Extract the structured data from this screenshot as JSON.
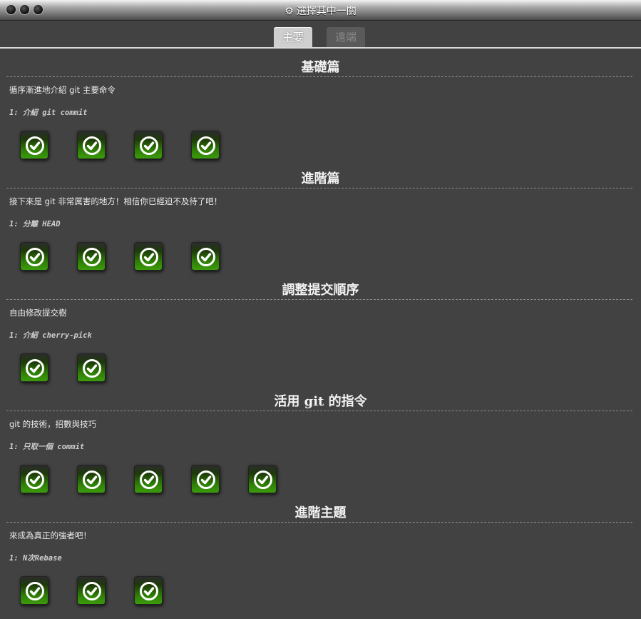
{
  "window": {
    "title": "選擇其中一關"
  },
  "tabs": [
    {
      "label": "主要",
      "active": true
    },
    {
      "label": "遠端",
      "active": false
    }
  ],
  "sequences": [
    {
      "title": "基礎篇",
      "about": "循序漸進地介紹 git 主要命令",
      "level_title": "1: 介紹 git commit",
      "level_count": 4
    },
    {
      "title": "進階篇",
      "about": "接下來是 git 非常厲害的地方！相信你已經迫不及待了吧！",
      "level_title": "1: 分離 HEAD",
      "level_count": 4
    },
    {
      "title": "調整提交順序",
      "about": "自由修改提交樹",
      "level_title": "1: 介紹 cherry-pick",
      "level_count": 2
    },
    {
      "title": "活用 git 的指令",
      "about": "git 的技術，招數與技巧",
      "level_title": "1: 只取一個 commit",
      "level_count": 5
    },
    {
      "title": "進階主題",
      "about": "來成為真正的強者吧！",
      "level_title": "1: N次Rebase",
      "level_count": 3
    }
  ],
  "icons": {
    "window_button": "circle-button",
    "gear": "gear-icon",
    "level": "check-circle-icon"
  },
  "colors": {
    "background": "#424242",
    "level_green": "#3c9b0c"
  }
}
